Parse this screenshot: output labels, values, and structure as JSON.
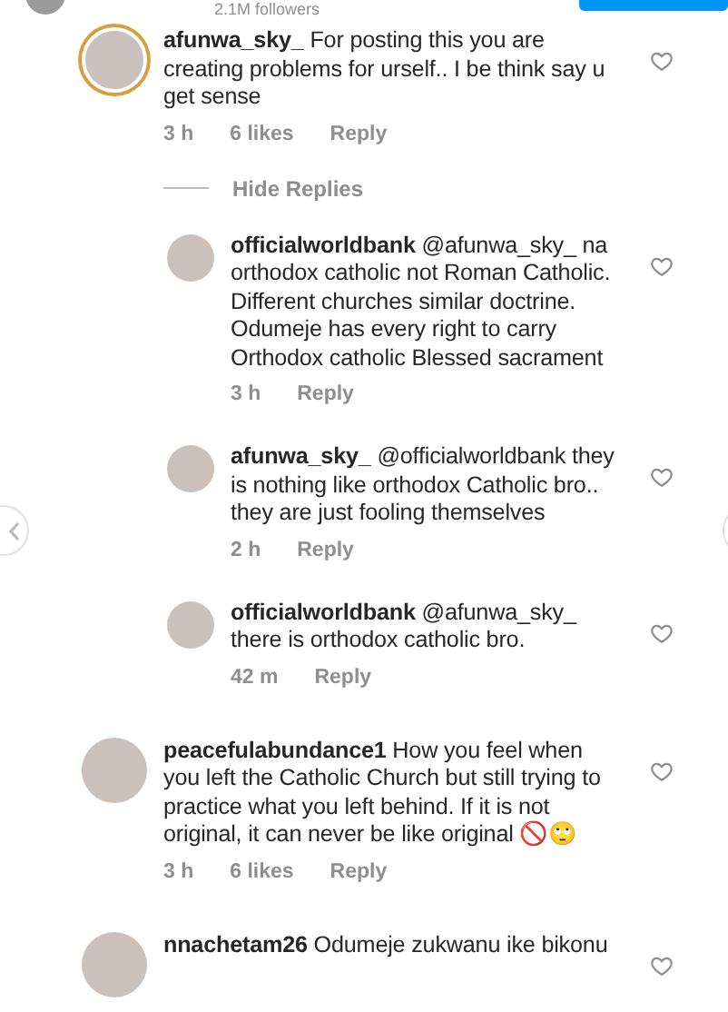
{
  "header": {
    "followers": "2.1M followers"
  },
  "comments": [
    {
      "ring": true,
      "text": "**afunwa_sky_** For posting this you are creating problems for urself.. I be think say u get sense",
      "time": "3 h",
      "likes": "6 likes",
      "reply": "Reply",
      "liked": false,
      "replies_toggle": "Hide Replies",
      "replies": [
        {
          "text": "**officialworldbank** @afunwa_sky_ na orthodox catholic not Roman Catholic. Different churches similar doctrine. Odumeje has every right to carry Orthodox catholic Blessed sacrament",
          "time": "3 h",
          "reply": "Reply",
          "liked": false
        },
        {
          "text": "**afunwa_sky_** @officialworldbank they is nothing like orthodox Catholic bro.. they are just fooling themselves",
          "time": "2 h",
          "reply": "Reply",
          "liked": false
        },
        {
          "text": "**officialworldbank** @afunwa_sky_ there is orthodox catholic bro.",
          "time": "42 m",
          "reply": "Reply",
          "liked": false
        }
      ]
    },
    {
      "ring": false,
      "text": "**peacefulabundance1** How you feel when you left the Catholic Church but still trying to practice what you left behind. If it is not original, it can never be like original 🚫🙄",
      "time": "3 h",
      "likes": "6 likes",
      "reply": "Reply",
      "liked": false
    },
    {
      "ring": false,
      "text": "**nnachetam26** Odumeje zukwanu ike bikonu",
      "liked": false
    }
  ]
}
